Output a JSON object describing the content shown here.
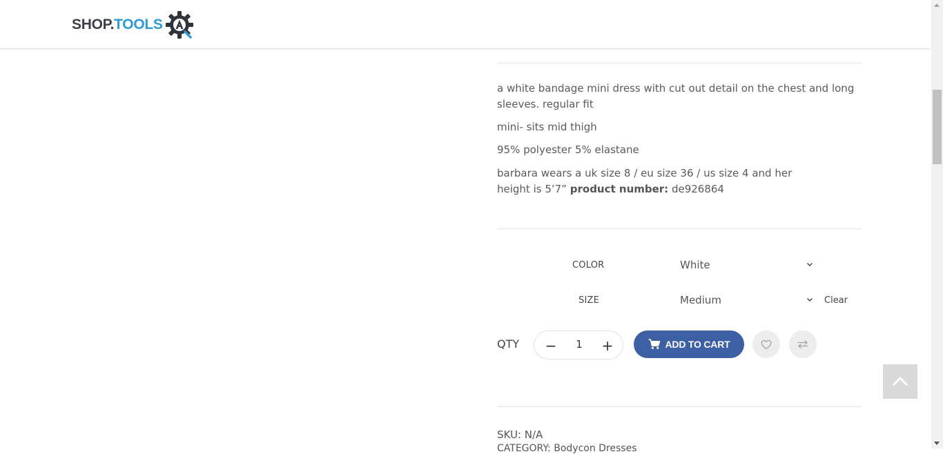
{
  "header": {
    "logo_part1": "SHOP.",
    "logo_part2": "TOOLS",
    "logo_icon": "gear-a-logo-icon"
  },
  "description": {
    "line1": "a white bandage mini dress with cut out detail on the chest and long sleeves. regular fit",
    "line2": "mini- sits mid thigh",
    "line3": "95% polyester 5% elastane",
    "line4": "barbara wears a uk size 8 / eu size 36 / us size 4 and her height is 5’7”",
    "product_number_label": "product number:",
    "product_number_value": "de926864"
  },
  "variations": {
    "color_label": "COLOR",
    "color_value": "White",
    "size_label": "SIZE",
    "size_value": "Medium",
    "clear_label": "Clear"
  },
  "purchase": {
    "qty_label": "QTY",
    "qty_value": "1",
    "minus_symbol": "−",
    "plus_symbol": "+",
    "add_to_cart_label": "ADD TO CART",
    "wishlist_icon": "heart-icon",
    "compare_icon": "compare-arrows-icon"
  },
  "meta": {
    "sku_label": "SKU:",
    "sku_value": "N/A",
    "category_label": "CATEGORY:",
    "category_value": "Bodycon Dresses"
  },
  "colors": {
    "accent": "#3d5fa3",
    "logo_blue": "#2e9ad6",
    "logo_dark": "#3a3f48"
  }
}
